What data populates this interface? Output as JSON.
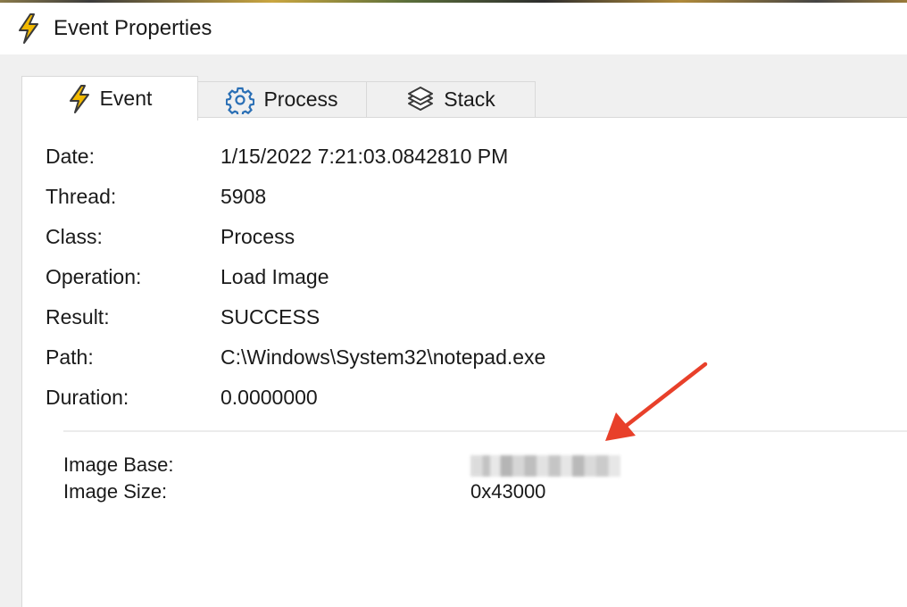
{
  "window": {
    "title": "Event Properties",
    "title_icon": "lightning-bolt-icon"
  },
  "tabs": [
    {
      "label": "Event",
      "icon": "lightning-bolt-icon",
      "active": true
    },
    {
      "label": "Process",
      "icon": "gear-icon",
      "active": false
    },
    {
      "label": "Stack",
      "icon": "stack-layers-icon",
      "active": false
    }
  ],
  "event": {
    "fields": [
      {
        "label": "Date:",
        "value": "1/15/2022 7:21:03.0842810 PM"
      },
      {
        "label": "Thread:",
        "value": "5908"
      },
      {
        "label": "Class:",
        "value": "Process"
      },
      {
        "label": "Operation:",
        "value": "Load Image"
      },
      {
        "label": "Result:",
        "value": "SUCCESS"
      },
      {
        "label": "Path:",
        "value": "C:\\Windows\\System32\\notepad.exe"
      },
      {
        "label": "Duration:",
        "value": "0.0000000"
      }
    ],
    "details": [
      {
        "label": "Image Base:",
        "value": ""
      },
      {
        "label": "Image Size:",
        "value": "0x43000"
      }
    ]
  },
  "annotation": {
    "arrow_color": "#e8402a"
  },
  "colors": {
    "bolt_fill": "#f2b900",
    "bolt_stroke": "#3a3a3a",
    "icon_blue": "#2a6fb5"
  }
}
